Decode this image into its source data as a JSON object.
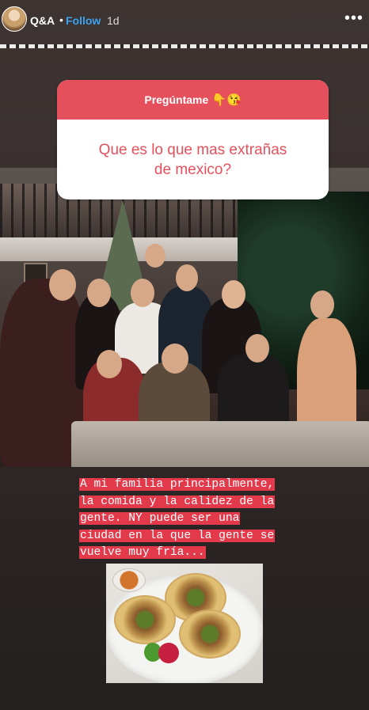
{
  "header": {
    "username": "Q&A",
    "separator": "•",
    "follow_label": "Follow",
    "time": "1d",
    "more_label": "•••"
  },
  "sticker": {
    "title": "Pregúntame",
    "emojis": "👇😘",
    "question_line1": "Que es lo que mas extrañas",
    "question_line2": "de mexico?"
  },
  "answer": {
    "lines": [
      "A mi familia principalmente,",
      "la comida y la calidez de la",
      "gente. NY puede ser una",
      "ciudad en la que la gente se",
      "vuelve muy fría..."
    ]
  },
  "colors": {
    "accent": "#e5505c",
    "highlight": "#e23a4b",
    "follow": "#3ea2f0"
  },
  "icons": {
    "avatar": "profile-avatar",
    "more": "more-options-icon"
  }
}
